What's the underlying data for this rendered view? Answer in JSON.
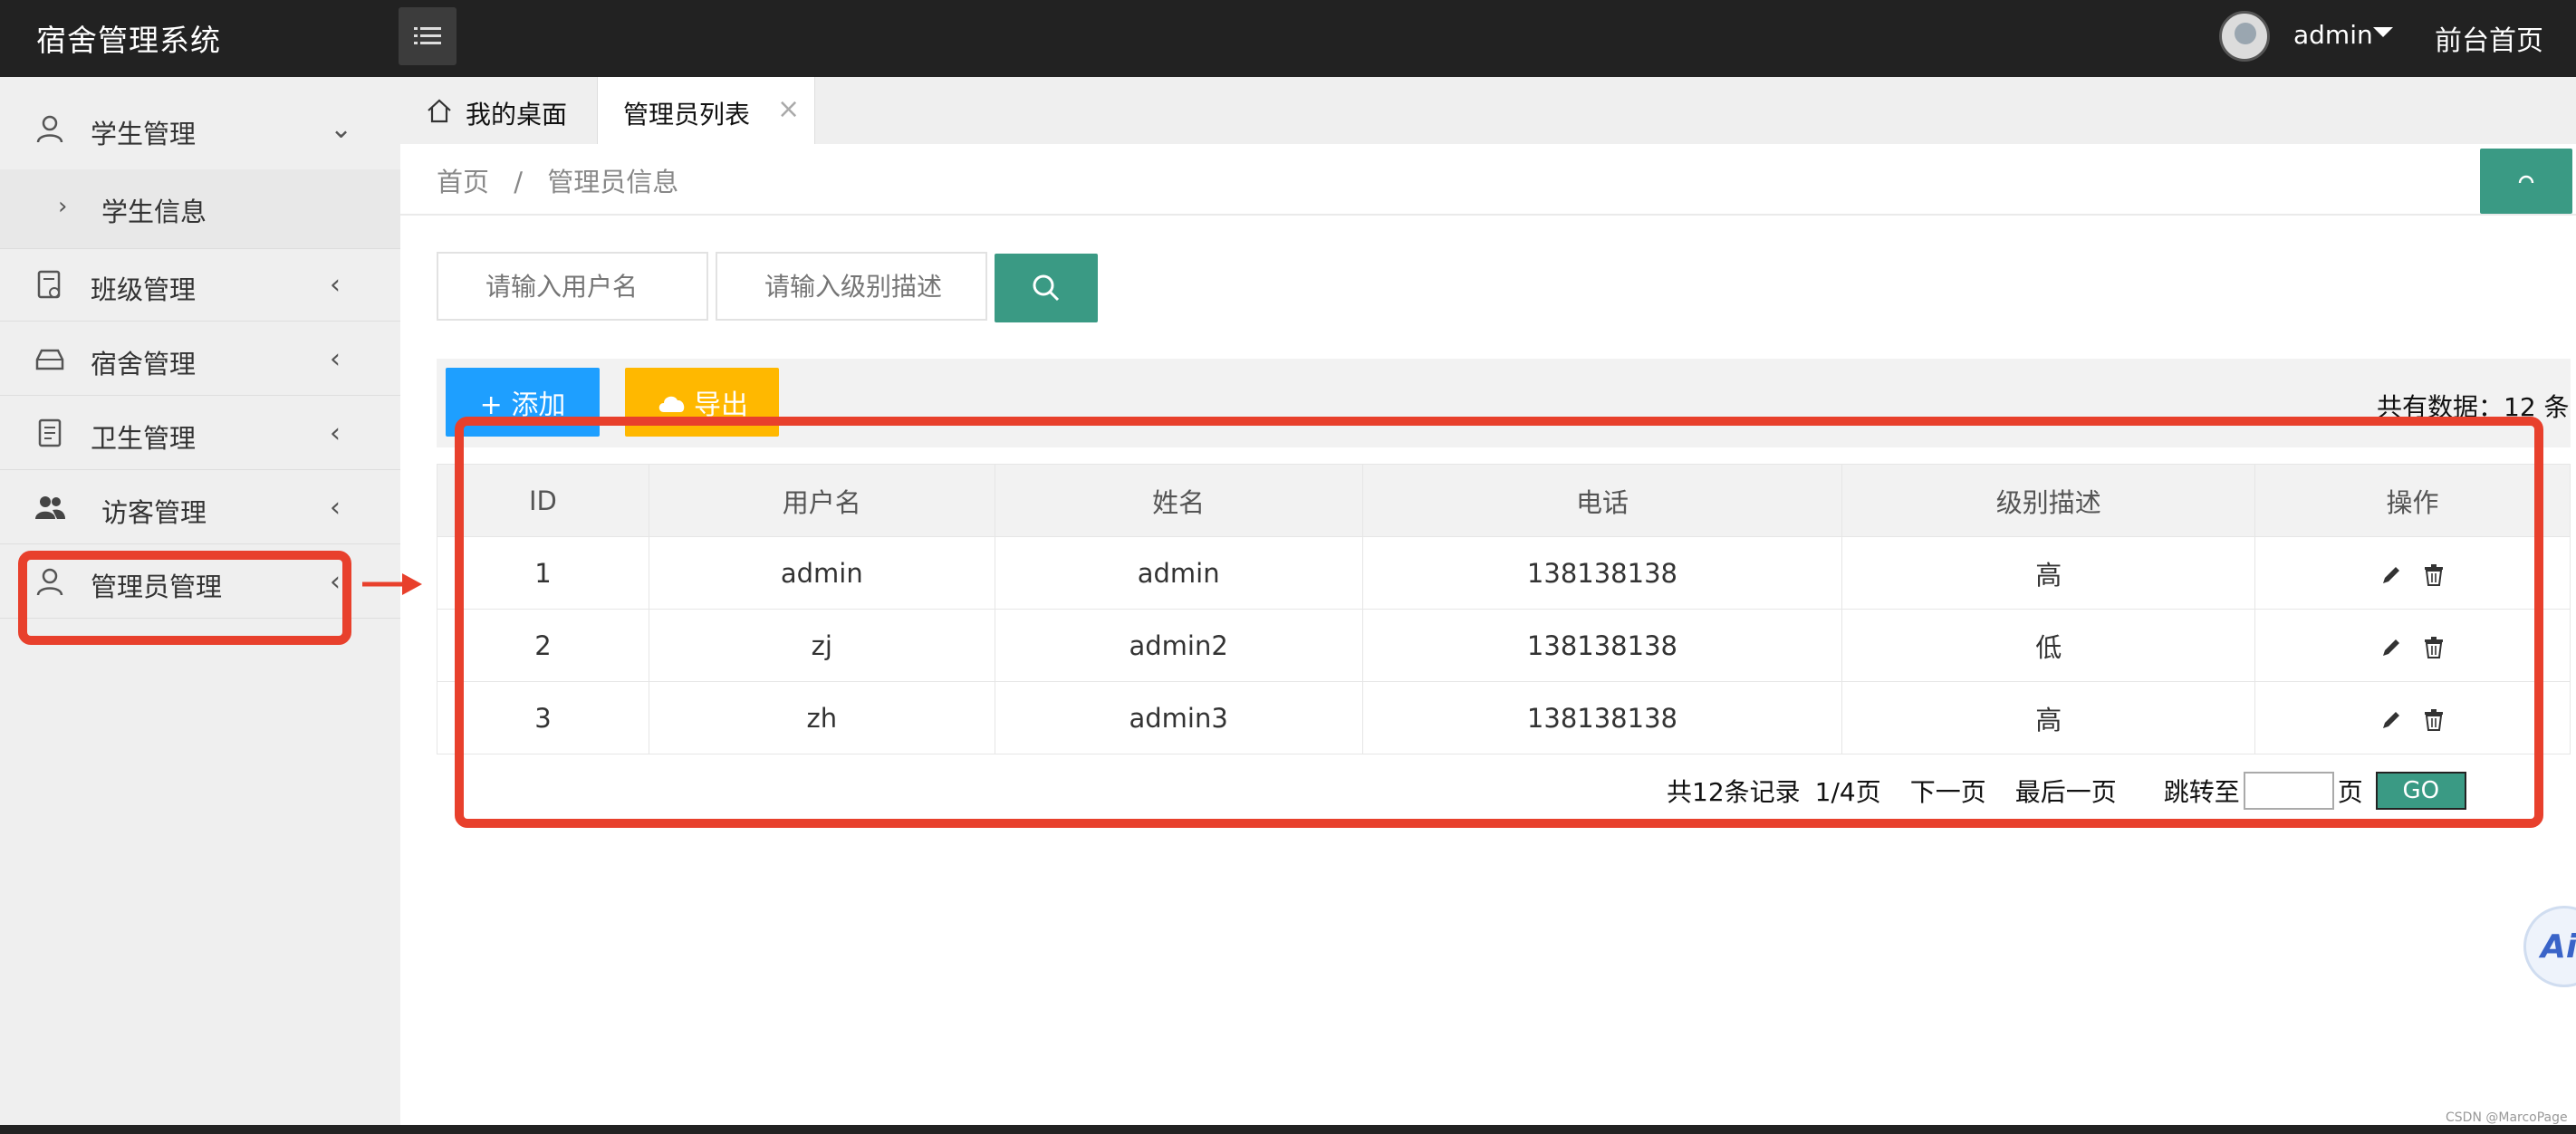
{
  "app": {
    "title": "宿舍管理系统"
  },
  "header": {
    "username": "admin",
    "front_link": "前台首页"
  },
  "sidebar": {
    "items": [
      {
        "label": "学生管理",
        "icon": "user-icon",
        "arrow": "⌄"
      },
      {
        "label": "班级管理",
        "icon": "class-icon",
        "arrow": "‹"
      },
      {
        "label": "宿舍管理",
        "icon": "dorm-icon",
        "arrow": "‹"
      },
      {
        "label": "卫生管理",
        "icon": "hygiene-icon",
        "arrow": "‹"
      },
      {
        "label": "访客管理",
        "icon": "visitor-icon",
        "arrow": "‹"
      },
      {
        "label": "管理员管理",
        "icon": "admin-icon",
        "arrow": "‹"
      }
    ],
    "sub_item": {
      "label": "学生信息",
      "chevron": "›"
    }
  },
  "tabs": [
    {
      "label": "我的桌面",
      "icon": "home-icon"
    },
    {
      "label": "管理员列表",
      "close": "×"
    }
  ],
  "breadcrumb": {
    "home": "首页",
    "separator": "/",
    "current": "管理员信息"
  },
  "search": {
    "username_placeholder": "请输入用户名",
    "level_placeholder": "请输入级别描述"
  },
  "toolbar": {
    "add_label": "+ 添加",
    "export_label": "导出",
    "total_text": "共有数据：12 条"
  },
  "table": {
    "headers": [
      "ID",
      "用户名",
      "姓名",
      "电话",
      "级别描述",
      "操作"
    ],
    "rows": [
      [
        "1",
        "admin",
        "admin",
        "138138138",
        "高"
      ],
      [
        "2",
        "zj",
        "admin2",
        "138138138",
        "低"
      ],
      [
        "3",
        "zh",
        "admin3",
        "138138138",
        "高"
      ]
    ]
  },
  "pagination": {
    "total_records": "共12条记录",
    "page_info": "1/4页",
    "next": "下一页",
    "last": "最后一页",
    "jump_to": "跳转至",
    "page_unit": "页",
    "go": "GO"
  },
  "colors": {
    "header_bg": "#222222",
    "accent_teal": "#3a9a84",
    "add_blue": "#1e9fff",
    "export_orange": "#ffb800",
    "annotation_red": "#e8402c"
  },
  "misc": {
    "ai_badge": "Ai",
    "watermark": "CSDN @MarcoPage"
  }
}
